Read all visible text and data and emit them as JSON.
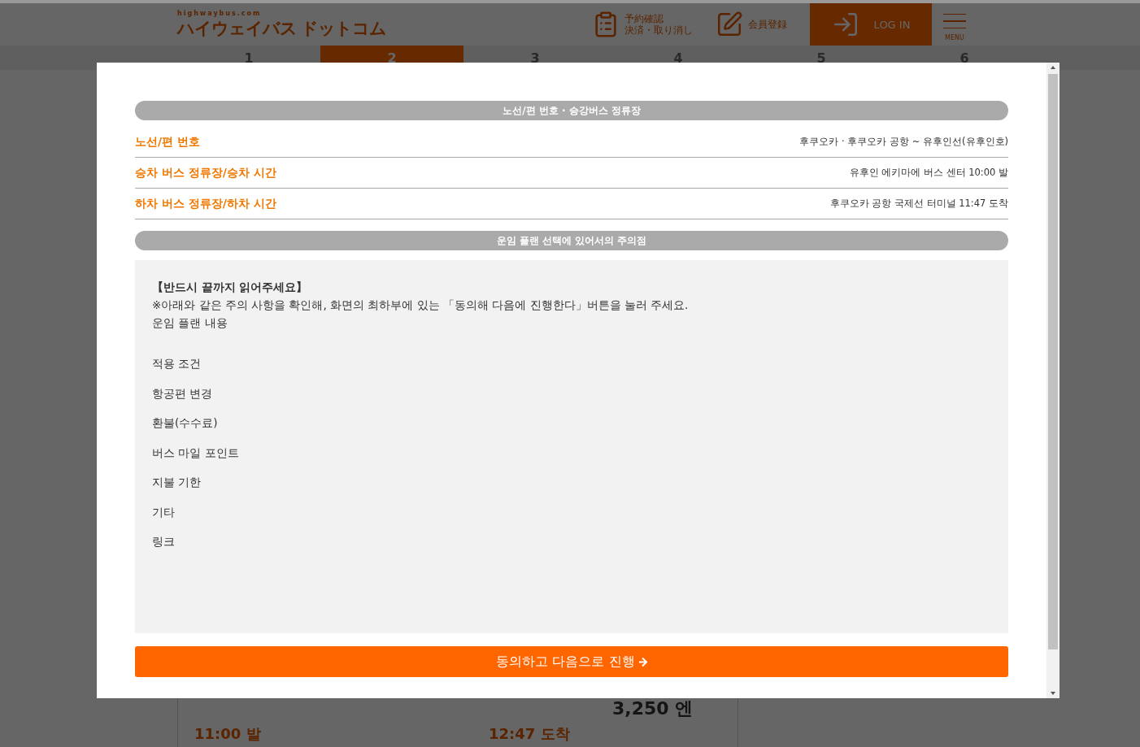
{
  "header": {
    "logo_caption": "highwaybus.com",
    "logo": "ハイウェイバス ドットコム",
    "links": [
      {
        "kind": "list",
        "lines": [
          "予約確認",
          "決済・取り消し"
        ]
      },
      {
        "kind": "pen",
        "lines": [
          "会員登録"
        ]
      }
    ],
    "login": "LOG IN",
    "menu": "MENU"
  },
  "steps": [
    {
      "number": "1",
      "selected": false
    },
    {
      "number": "2",
      "selected": true
    },
    {
      "number": "3",
      "selected": false
    },
    {
      "number": "4",
      "selected": false
    },
    {
      "number": "5",
      "selected": false
    },
    {
      "number": "6",
      "selected": false
    }
  ],
  "card": {
    "price": "3,250 엔",
    "departure": "11:00 발",
    "arrival": "12:47 도착"
  },
  "modal": {
    "route_section": {
      "title": "노선/편 번호 · 승강버스 정류장",
      "rows": [
        {
          "label": "노선/편 번호",
          "value": "후쿠오카 · 후쿠오카 공항 ~ 유후인선(유후인호)"
        },
        {
          "label": "승차 버스 정류장/승차 시간",
          "value": "유후인 에키마에 버스 센터 10:00 발"
        },
        {
          "label": "하차 버스 정류장/하차 시간",
          "value": "후쿠오카 공항 국제선 터미널 11:47 도착"
        }
      ]
    },
    "notice_section": {
      "title": "운임 플랜 선택에 있어서의 주의점",
      "heading": "【반드시 끝까지 읽어주세요】",
      "instruction": "※아래와 같은 주의 사항을 확인해, 화면의 최하부에 있는 「동의해 다음에 진행한다」버튼을 눌러 주세요.",
      "subheading": "운임 플랜 내용",
      "items": [
        "적용 조건",
        "항공편 변경",
        "환불(수수료)",
        "버스 마일 포인트",
        "지불 기한",
        "기타",
        "링크"
      ]
    },
    "agree_button": "동의하고 다음으로 진행"
  }
}
